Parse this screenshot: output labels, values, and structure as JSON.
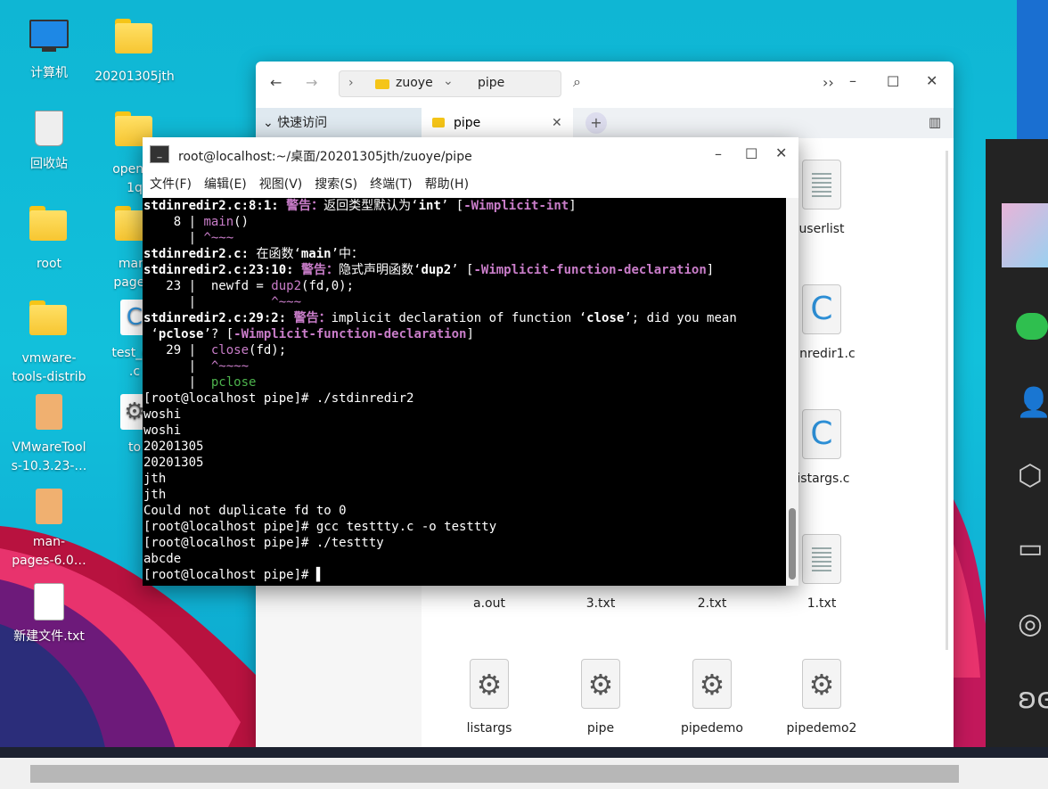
{
  "desktop": {
    "icons": [
      {
        "label": "计算机",
        "kind": "monitor"
      },
      {
        "label": "20201305jth",
        "kind": "folder"
      },
      {
        "label": "回收站",
        "kind": "trash"
      },
      {
        "label": "openss\n1q",
        "kind": "folder"
      },
      {
        "label": "root",
        "kind": "home-folder"
      },
      {
        "label": "man-\npages-",
        "kind": "folder"
      },
      {
        "label": "vmware-\ntools-distrib",
        "kind": "folder"
      },
      {
        "label": "test_op\n.c",
        "kind": "c-file"
      },
      {
        "label": "VMwareTool\ns-10.3.23-…",
        "kind": "package"
      },
      {
        "label": "to",
        "kind": "gear"
      },
      {
        "label": "man-\npages-6.0…",
        "kind": "package"
      },
      {
        "label": "新建文件.txt",
        "kind": "text"
      }
    ]
  },
  "file_manager": {
    "path": [
      "zuoye",
      "pipe"
    ],
    "sidebar_header": "快速访问",
    "tab_label": "pipe",
    "files": [
      {
        "name": "userlist",
        "kind": "text"
      },
      {
        "name": "dinredir1.c",
        "kind": "c-file"
      },
      {
        "name": "listargs.c",
        "kind": "c-file"
      },
      {
        "name": "a.out",
        "kind": "exec"
      },
      {
        "name": "3.txt",
        "kind": "text"
      },
      {
        "name": "2.txt",
        "kind": "text"
      },
      {
        "name": "1.txt",
        "kind": "text"
      },
      {
        "name": "listargs",
        "kind": "exec"
      },
      {
        "name": "pipe",
        "kind": "exec"
      },
      {
        "name": "pipedemo",
        "kind": "exec"
      },
      {
        "name": "pipedemo2",
        "kind": "exec"
      }
    ]
  },
  "terminal": {
    "title": "root@localhost:~/桌面/20201305jth/zuoye/pipe",
    "menu": [
      "文件(F)",
      "编辑(E)",
      "视图(V)",
      "搜索(S)",
      "终端(T)",
      "帮助(H)"
    ],
    "lines": [
      [
        {
          "t": "stdinredir2.c:8:1: ",
          "c": "b"
        },
        {
          "t": "警告：",
          "c": "mb"
        },
        {
          "t": "返回类型默认为‘"
        },
        {
          "t": "int",
          "c": "b"
        },
        {
          "t": "’ ["
        },
        {
          "t": "-Wimplicit-int",
          "c": "mb"
        },
        {
          "t": "]"
        }
      ],
      [
        {
          "t": "    8 | "
        },
        {
          "t": "main",
          "c": "m"
        },
        {
          "t": "()"
        }
      ],
      [
        {
          "t": "      | "
        },
        {
          "t": "^~~~",
          "c": "m"
        }
      ],
      [
        {
          "t": "stdinredir2.c:",
          "c": "b"
        },
        {
          "t": " 在函数‘"
        },
        {
          "t": "main",
          "c": "b"
        },
        {
          "t": "’中："
        }
      ],
      [
        {
          "t": "stdinredir2.c:23:10: ",
          "c": "b"
        },
        {
          "t": "警告：",
          "c": "mb"
        },
        {
          "t": "隐式声明函数‘"
        },
        {
          "t": "dup2",
          "c": "b"
        },
        {
          "t": "’ ["
        },
        {
          "t": "-Wimplicit-function-declaration",
          "c": "mb"
        },
        {
          "t": "]"
        }
      ],
      [
        {
          "t": "   23 |  newfd = "
        },
        {
          "t": "dup2",
          "c": "m"
        },
        {
          "t": "(fd,0);"
        }
      ],
      [
        {
          "t": "      |          "
        },
        {
          "t": "^~~~",
          "c": "m"
        }
      ],
      [
        {
          "t": "stdinredir2.c:29:2: ",
          "c": "b"
        },
        {
          "t": "警告：",
          "c": "mb"
        },
        {
          "t": "implicit declaration of function ‘"
        },
        {
          "t": "close",
          "c": "b"
        },
        {
          "t": "’; did you mean"
        }
      ],
      [
        {
          "t": " ‘"
        },
        {
          "t": "pclose",
          "c": "b"
        },
        {
          "t": "’? ["
        },
        {
          "t": "-Wimplicit-function-declaration",
          "c": "mb"
        },
        {
          "t": "]"
        }
      ],
      [
        {
          "t": "   29 |  "
        },
        {
          "t": "close",
          "c": "m"
        },
        {
          "t": "(fd);"
        }
      ],
      [
        {
          "t": "      |  "
        },
        {
          "t": "^~~~~",
          "c": "m"
        }
      ],
      [
        {
          "t": "      |  "
        },
        {
          "t": "pclose",
          "c": "g"
        }
      ],
      [
        {
          "t": "[root@localhost pipe]# ./stdinredir2"
        }
      ],
      [
        {
          "t": "woshi"
        }
      ],
      [
        {
          "t": "woshi"
        }
      ],
      [
        {
          "t": "20201305"
        }
      ],
      [
        {
          "t": "20201305"
        }
      ],
      [
        {
          "t": "jth"
        }
      ],
      [
        {
          "t": "jth"
        }
      ],
      [
        {
          "t": "Could not duplicate fd to 0"
        }
      ],
      [
        {
          "t": "[root@localhost pipe]# gcc testtty.c -o testtty"
        }
      ],
      [
        {
          "t": "[root@localhost pipe]# ./testtty"
        }
      ],
      [
        {
          "t": "abcde"
        }
      ],
      [
        {
          "t": "[root@localhost pipe]# "
        },
        {
          "t": "▌",
          "c": "cur"
        }
      ]
    ]
  }
}
